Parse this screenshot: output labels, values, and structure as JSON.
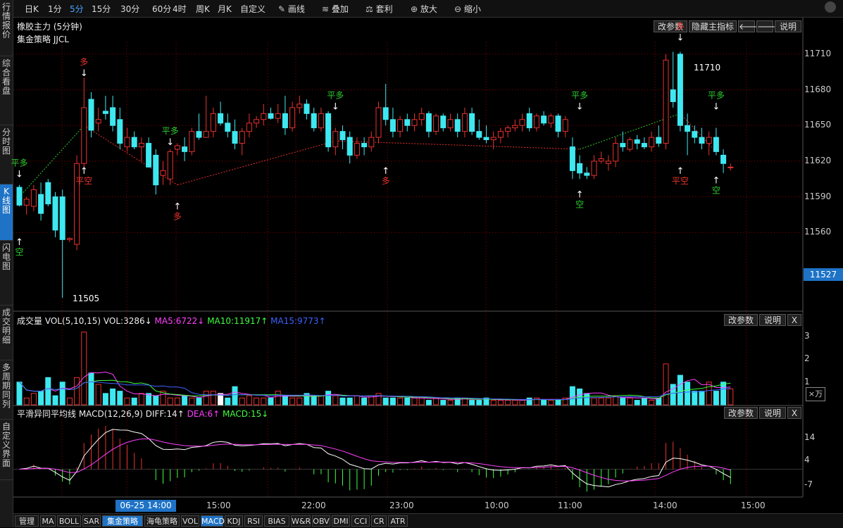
{
  "leftbar": [
    "行情报价",
    "综合看盘",
    "分时图",
    "K线图",
    "闪电图",
    "成交明细",
    "多周期同列",
    "自定义界面"
  ],
  "toolbar": {
    "period_items": [
      "日K",
      "1分",
      "5分",
      "15分",
      "30分",
      "60分",
      "4时",
      "周K",
      "月K",
      "自定义"
    ],
    "active_period": "5分",
    "draw_label": "画线",
    "overlay_label": "叠加",
    "arb_label": "套利",
    "zoom_in_label": "放大",
    "zoom_out_label": "缩小"
  },
  "main_panel": {
    "title": "橡胶主力 (5分钟)",
    "indicator": "集金策略 JJCL",
    "btn_params": "改参数",
    "btn_hide": "隐藏主指标",
    "btn_help": "说明",
    "price_ticks": [
      "11710",
      "11680",
      "11650",
      "11620",
      "11590",
      "11560"
    ],
    "current_price": "11527",
    "high_label": "11710",
    "low_label": "11505"
  },
  "vol_panel": {
    "title": "成交量 VOL(5,10,15) VOL:3286↓",
    "ma5": "MA5:6722↓",
    "ma10": "MA10:11917↑",
    "ma15": "MA15:9773↑",
    "btn_params": "改参数",
    "btn_help": "说明",
    "btn_close": "X",
    "ticks": [
      "3",
      "2",
      "1"
    ],
    "unit": "×万"
  },
  "macd_panel": {
    "title": "平滑异同平均线 MACD(12,26,9) DIFF:14↑",
    "dea": "DEA:6↑",
    "macd": "MACD:15↓",
    "btn_params": "改参数",
    "btn_help": "说明",
    "btn_close": "X",
    "ticks": [
      "14",
      "4",
      "-7"
    ]
  },
  "time_axis": {
    "cursor_label": "06-25 14:00",
    "labels": [
      "15:00",
      "22:00",
      "23:00",
      "10:00",
      "11:00",
      "14:00",
      "15:00"
    ]
  },
  "bottom_tabs": [
    "管理",
    "MA",
    "BOLL",
    "SAR",
    "集金策略",
    "海龟策略",
    "VOL",
    "MACD",
    "KDJ",
    "RSI",
    "BIAS",
    "W&R",
    "OBV",
    "DMI",
    "CCI",
    "CR",
    "ATR"
  ],
  "signals": {
    "long": "多",
    "short": "空",
    "close_long": "平多",
    "close_short": "平空"
  },
  "colors": {
    "up": "#e8322e",
    "down": "#3ee8f0",
    "grid": "#8b0000",
    "accent": "#1e73c6",
    "ma5": "#ff40ff",
    "ma10": "#40ff40",
    "ma15": "#4060ff"
  },
  "chart_data": {
    "type": "candlestick",
    "y_range": [
      11495,
      11720
    ],
    "candles": [
      {
        "o": 11598,
        "h": 11600,
        "l": 11582,
        "c": 11583
      },
      {
        "o": 11583,
        "h": 11590,
        "l": 11575,
        "c": 11588
      },
      {
        "o": 11582,
        "h": 11600,
        "l": 11578,
        "c": 11596
      },
      {
        "o": 11592,
        "h": 11602,
        "l": 11570,
        "c": 11576
      },
      {
        "o": 11602,
        "h": 11605,
        "l": 11582,
        "c": 11584
      },
      {
        "o": 11590,
        "h": 11594,
        "l": 11556,
        "c": 11562
      },
      {
        "o": 11590,
        "h": 11596,
        "l": 11505,
        "c": 11554
      },
      {
        "o": 11554,
        "h": 11556,
        "l": 11552,
        "c": 11555
      },
      {
        "o": 11550,
        "h": 11625,
        "l": 11545,
        "c": 11618
      },
      {
        "o": 11618,
        "h": 11690,
        "l": 11612,
        "c": 11665
      },
      {
        "o": 11672,
        "h": 11678,
        "l": 11640,
        "c": 11646
      },
      {
        "o": 11652,
        "h": 11665,
        "l": 11645,
        "c": 11655
      },
      {
        "o": 11662,
        "h": 11675,
        "l": 11655,
        "c": 11660
      },
      {
        "o": 11665,
        "h": 11675,
        "l": 11645,
        "c": 11650
      },
      {
        "o": 11655,
        "h": 11665,
        "l": 11630,
        "c": 11635
      },
      {
        "o": 11632,
        "h": 11648,
        "l": 11628,
        "c": 11640
      },
      {
        "o": 11640,
        "h": 11645,
        "l": 11630,
        "c": 11632
      },
      {
        "o": 11632,
        "h": 11640,
        "l": 11620,
        "c": 11635
      },
      {
        "o": 11635,
        "h": 11640,
        "l": 11615,
        "c": 11615
      },
      {
        "o": 11625,
        "h": 11630,
        "l": 11592,
        "c": 11600
      },
      {
        "o": 11608,
        "h": 11620,
        "l": 11600,
        "c": 11612
      },
      {
        "o": 11605,
        "h": 11630,
        "l": 11600,
        "c": 11628
      },
      {
        "o": 11630,
        "h": 11635,
        "l": 11625,
        "c": 11633
      },
      {
        "o": 11632,
        "h": 11640,
        "l": 11620,
        "c": 11628
      },
      {
        "o": 11628,
        "h": 11648,
        "l": 11625,
        "c": 11645
      },
      {
        "o": 11645,
        "h": 11660,
        "l": 11638,
        "c": 11640
      },
      {
        "o": 11640,
        "h": 11675,
        "l": 11640,
        "c": 11645
      },
      {
        "o": 11645,
        "h": 11665,
        "l": 11640,
        "c": 11660
      },
      {
        "o": 11660,
        "h": 11670,
        "l": 11650,
        "c": 11652
      },
      {
        "o": 11652,
        "h": 11660,
        "l": 11640,
        "c": 11645
      },
      {
        "o": 11645,
        "h": 11655,
        "l": 11630,
        "c": 11635
      },
      {
        "o": 11635,
        "h": 11648,
        "l": 11625,
        "c": 11645
      },
      {
        "o": 11645,
        "h": 11660,
        "l": 11640,
        "c": 11652
      },
      {
        "o": 11652,
        "h": 11658,
        "l": 11648,
        "c": 11655
      },
      {
        "o": 11655,
        "h": 11668,
        "l": 11650,
        "c": 11660
      },
      {
        "o": 11660,
        "h": 11665,
        "l": 11655,
        "c": 11656
      },
      {
        "o": 11656,
        "h": 11668,
        "l": 11652,
        "c": 11660
      },
      {
        "o": 11660,
        "h": 11675,
        "l": 11642,
        "c": 11648
      },
      {
        "o": 11648,
        "h": 11670,
        "l": 11645,
        "c": 11665
      },
      {
        "o": 11665,
        "h": 11675,
        "l": 11660,
        "c": 11668
      },
      {
        "o": 11668,
        "h": 11672,
        "l": 11655,
        "c": 11660
      },
      {
        "o": 11660,
        "h": 11665,
        "l": 11645,
        "c": 11648
      },
      {
        "o": 11648,
        "h": 11665,
        "l": 11645,
        "c": 11660
      },
      {
        "o": 11660,
        "h": 11662,
        "l": 11628,
        "c": 11632
      },
      {
        "o": 11632,
        "h": 11648,
        "l": 11625,
        "c": 11645
      },
      {
        "o": 11645,
        "h": 11650,
        "l": 11630,
        "c": 11638
      },
      {
        "o": 11640,
        "h": 11645,
        "l": 11618,
        "c": 11625
      },
      {
        "o": 11625,
        "h": 11640,
        "l": 11622,
        "c": 11635
      },
      {
        "o": 11635,
        "h": 11640,
        "l": 11625,
        "c": 11632
      },
      {
        "o": 11632,
        "h": 11645,
        "l": 11628,
        "c": 11640
      },
      {
        "o": 11640,
        "h": 11670,
        "l": 11635,
        "c": 11665
      },
      {
        "o": 11665,
        "h": 11685,
        "l": 11650,
        "c": 11655
      },
      {
        "o": 11655,
        "h": 11665,
        "l": 11640,
        "c": 11645
      },
      {
        "o": 11645,
        "h": 11658,
        "l": 11640,
        "c": 11655
      },
      {
        "o": 11655,
        "h": 11660,
        "l": 11645,
        "c": 11650
      },
      {
        "o": 11650,
        "h": 11660,
        "l": 11645,
        "c": 11655
      },
      {
        "o": 11655,
        "h": 11665,
        "l": 11650,
        "c": 11660
      },
      {
        "o": 11660,
        "h": 11662,
        "l": 11640,
        "c": 11645
      },
      {
        "o": 11645,
        "h": 11660,
        "l": 11642,
        "c": 11658
      },
      {
        "o": 11658,
        "h": 11660,
        "l": 11645,
        "c": 11648
      },
      {
        "o": 11648,
        "h": 11660,
        "l": 11645,
        "c": 11655
      },
      {
        "o": 11655,
        "h": 11660,
        "l": 11640,
        "c": 11645
      },
      {
        "o": 11645,
        "h": 11665,
        "l": 11640,
        "c": 11660
      },
      {
        "o": 11660,
        "h": 11665,
        "l": 11642,
        "c": 11645
      },
      {
        "o": 11645,
        "h": 11655,
        "l": 11638,
        "c": 11640
      },
      {
        "o": 11640,
        "h": 11650,
        "l": 11635,
        "c": 11638
      },
      {
        "o": 11638,
        "h": 11645,
        "l": 11630,
        "c": 11640
      },
      {
        "o": 11640,
        "h": 11648,
        "l": 11635,
        "c": 11645
      },
      {
        "o": 11645,
        "h": 11650,
        "l": 11640,
        "c": 11648
      },
      {
        "o": 11648,
        "h": 11655,
        "l": 11645,
        "c": 11650
      },
      {
        "o": 11650,
        "h": 11660,
        "l": 11645,
        "c": 11655
      },
      {
        "o": 11660,
        "h": 11665,
        "l": 11645,
        "c": 11648
      },
      {
        "o": 11648,
        "h": 11660,
        "l": 11645,
        "c": 11658
      },
      {
        "o": 11658,
        "h": 11662,
        "l": 11650,
        "c": 11652
      },
      {
        "o": 11652,
        "h": 11660,
        "l": 11648,
        "c": 11658
      },
      {
        "o": 11658,
        "h": 11660,
        "l": 11640,
        "c": 11645
      },
      {
        "o": 11645,
        "h": 11658,
        "l": 11640,
        "c": 11655
      },
      {
        "o": 11632,
        "h": 11640,
        "l": 11605,
        "c": 11612
      },
      {
        "o": 11618,
        "h": 11625,
        "l": 11605,
        "c": 11610
      },
      {
        "o": 11610,
        "h": 11615,
        "l": 11605,
        "c": 11608
      },
      {
        "o": 11608,
        "h": 11625,
        "l": 11605,
        "c": 11620
      },
      {
        "o": 11620,
        "h": 11628,
        "l": 11618,
        "c": 11622
      },
      {
        "o": 11618,
        "h": 11625,
        "l": 11612,
        "c": 11620
      },
      {
        "o": 11620,
        "h": 11640,
        "l": 11615,
        "c": 11635
      },
      {
        "o": 11635,
        "h": 11645,
        "l": 11628,
        "c": 11632
      },
      {
        "o": 11630,
        "h": 11640,
        "l": 11628,
        "c": 11638
      },
      {
        "o": 11638,
        "h": 11642,
        "l": 11630,
        "c": 11635
      },
      {
        "o": 11635,
        "h": 11640,
        "l": 11630,
        "c": 11632
      },
      {
        "o": 11632,
        "h": 11645,
        "l": 11628,
        "c": 11640
      },
      {
        "o": 11640,
        "h": 11650,
        "l": 11632,
        "c": 11635
      },
      {
        "o": 11635,
        "h": 11710,
        "l": 11630,
        "c": 11705
      },
      {
        "o": 11680,
        "h": 11712,
        "l": 11665,
        "c": 11670
      },
      {
        "o": 11710,
        "h": 11712,
        "l": 11645,
        "c": 11650
      },
      {
        "o": 11650,
        "h": 11660,
        "l": 11625,
        "c": 11645
      },
      {
        "o": 11645,
        "h": 11650,
        "l": 11635,
        "c": 11640
      },
      {
        "o": 11640,
        "h": 11648,
        "l": 11630,
        "c": 11635
      },
      {
        "o": 11635,
        "h": 11645,
        "l": 11625,
        "c": 11640
      },
      {
        "o": 11640,
        "h": 11648,
        "l": 11625,
        "c": 11628
      },
      {
        "o": 11625,
        "h": 11630,
        "l": 11610,
        "c": 11618
      },
      {
        "o": 11615,
        "h": 11618,
        "l": 11612,
        "c": 11615
      }
    ],
    "volume": [
      1.0,
      0.3,
      0.5,
      0.6,
      1.2,
      0.4,
      1.0,
      0.3,
      1.2,
      3.2,
      1.4,
      0.9,
      0.5,
      0.7,
      0.6,
      0.3,
      0.3,
      0.5,
      0.5,
      0.4,
      0.6,
      0.3,
      0.3,
      0.4,
      0.3,
      0.3,
      0.6,
      0.6,
      0.5,
      0.3,
      0.8,
      0.3,
      0.4,
      0.3,
      0.3,
      0.3,
      0.6,
      0.4,
      0.3,
      0.3,
      0.5,
      0.4,
      0.4,
      0.6,
      0.4,
      0.3,
      0.3,
      0.4,
      0.3,
      0.4,
      0.5,
      0.3,
      0.3,
      0.3,
      0.3,
      0.3,
      0.3,
      0.2,
      0.3,
      0.2,
      0.2,
      0.3,
      0.3,
      0.2,
      0.2,
      0.3,
      0.2,
      0.2,
      0.2,
      0.2,
      0.2,
      0.3,
      0.3,
      0.2,
      0.2,
      0.2,
      0.3,
      0.8,
      0.7,
      0.5,
      0.3,
      0.3,
      0.3,
      0.4,
      0.3,
      0.3,
      0.2,
      0.3,
      0.2,
      0.3,
      1.8,
      0.9,
      1.3,
      1.0,
      0.6,
      0.6,
      1.0,
      0.6,
      1.0,
      0.7
    ],
    "volume_ylim": [
      0,
      3.5
    ],
    "macd_ylim": [
      -12,
      22
    ]
  }
}
